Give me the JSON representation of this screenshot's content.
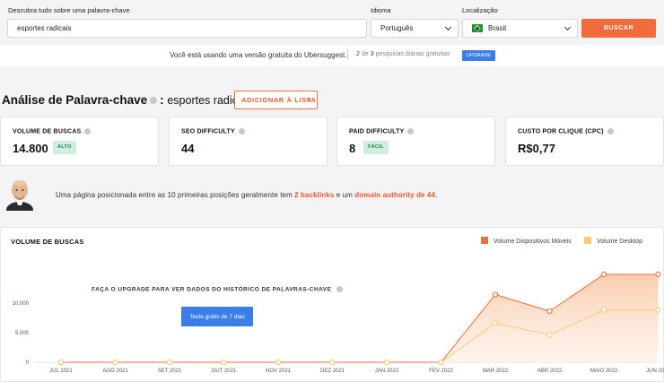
{
  "search": {
    "keyword_label": "Descubra tudo sobre uma palavra-chave",
    "keyword_value": "esportes radicais",
    "language_label": "Idioma",
    "language_value": "Português",
    "location_label": "Localização",
    "location_value": "Brasil",
    "submit_label": "BUSCAR"
  },
  "notice": {
    "text": "Você está usando uma versão gratuita do Ubersuggest.",
    "used": "2",
    "of": "de",
    "total": "3",
    "suffix": "pesquisas diárias gratuitas",
    "upgrade_label": "UPGRADE"
  },
  "analysis": {
    "title": "Análise de Palavra-chave",
    "colon": ":",
    "keyword": "esportes radicais",
    "add_list_label": "ADICIONAR À LISTA"
  },
  "metrics": [
    {
      "title": "VOLUME DE BUSCAS",
      "value": "14.800",
      "badge": "ALTO"
    },
    {
      "title": "SEO DIFFICULTY",
      "value": "44",
      "badge": ""
    },
    {
      "title": "PAID DIFFICULTY",
      "value": "8",
      "badge": "FÁCIL"
    },
    {
      "title": "CUSTO POR CLIQUE (CPC)",
      "value": "R$0,77",
      "badge": ""
    }
  ],
  "advice": {
    "text1": "Uma página posicionada entre as 10 primeiras posições geralmente tem",
    "highlight1": "2 backlinks",
    "text2": "e um",
    "highlight2": "domain authority de 44",
    "text3": "."
  },
  "volume_chart": {
    "title": "VOLUME DE BUSCAS",
    "upgrade_message": "FAÇA O UPGRADE PARA VER DADOS DO HISTÓRICO DE PALAVRAS-CHAVE",
    "trial_label": "Teste grátis de 7 dias"
  },
  "chart_data": {
    "type": "line",
    "x": [
      "JUL 2021",
      "AGO 2021",
      "SET 2021",
      "OUT 2021",
      "NOV 2021",
      "DEZ 2021",
      "JAN 2022",
      "FEV 2022",
      "MAR 2022",
      "ABR 2022",
      "MAIO 2022",
      "JUN 2022"
    ],
    "series": [
      {
        "name": "Volume Dispositivos Móveis",
        "color": "#f26b3a",
        "values": [
          0,
          0,
          0,
          0,
          0,
          0,
          0,
          0,
          11400,
          8600,
          14800,
          14800
        ]
      },
      {
        "name": "Volume Desktop",
        "color": "#fccb6e",
        "values": [
          0,
          0,
          0,
          0,
          0,
          0,
          0,
          0,
          6600,
          4600,
          8800,
          8800
        ]
      }
    ],
    "yticks": [
      "0",
      "5.000",
      "10.000"
    ],
    "ylim": [
      0,
      16000
    ],
    "area_fill": true,
    "legend_position": "top-right"
  }
}
